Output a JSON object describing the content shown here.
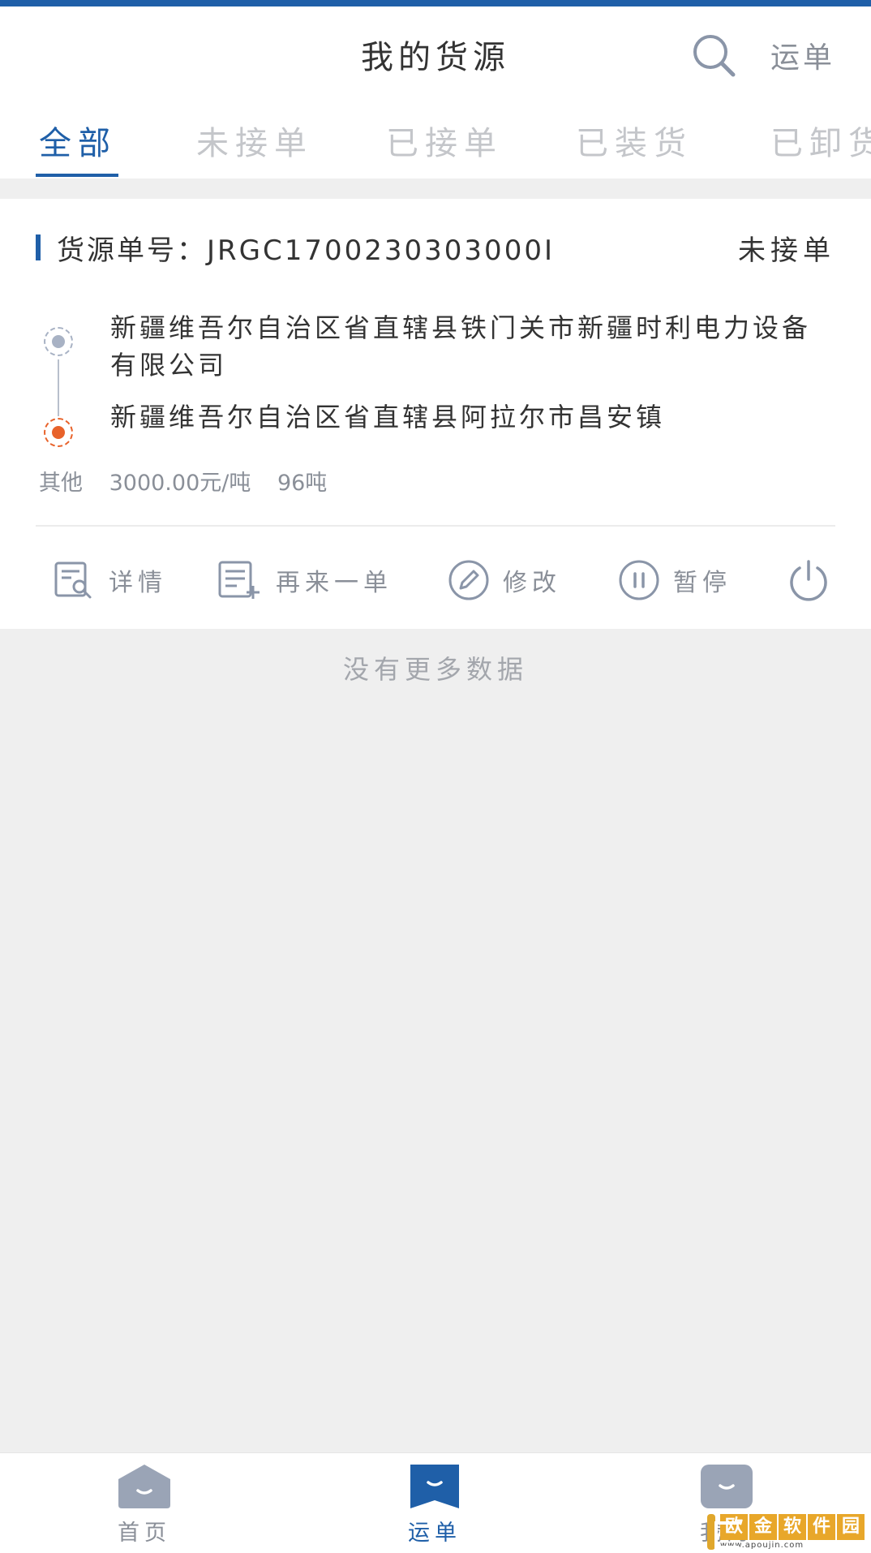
{
  "header": {
    "title": "我的货源",
    "waybill_label": "运单",
    "search_icon": "search-icon"
  },
  "tabs": [
    {
      "label": "全部",
      "active": true
    },
    {
      "label": "未接单",
      "active": false
    },
    {
      "label": "已接单",
      "active": false
    },
    {
      "label": "已装货",
      "active": false
    },
    {
      "label": "已卸货",
      "active": false
    }
  ],
  "card": {
    "order_label": "货源单号：JRGC1700230303000I",
    "status": "未接单",
    "from_address": "新疆维吾尔自治区省直辖县铁门关市新疆时利电力设备有限公司",
    "to_address": "新疆维吾尔自治区省直辖县阿拉尔市昌安镇",
    "cargo_type": "其他",
    "price": "3000.00元/吨",
    "weight": "96吨",
    "actions": [
      {
        "label": "详情",
        "icon": "detail-icon"
      },
      {
        "label": "再来一单",
        "icon": "add-order-icon"
      },
      {
        "label": "修改",
        "icon": "edit-icon"
      },
      {
        "label": "暂停",
        "icon": "pause-icon"
      },
      {
        "label": "",
        "icon": "power-icon"
      }
    ]
  },
  "no_more_text": "没有更多数据",
  "bottom_nav": [
    {
      "label": "首页",
      "active": false
    },
    {
      "label": "运单",
      "active": true
    },
    {
      "label": "我的",
      "active": false
    }
  ],
  "watermark": {
    "title": "欧金软件园",
    "url": "www.apoujin.com"
  },
  "colors": {
    "accent": "#1f5fa8",
    "destination": "#e8622a",
    "origin": "#a8b2c4",
    "muted_text": "#8a8f98"
  }
}
